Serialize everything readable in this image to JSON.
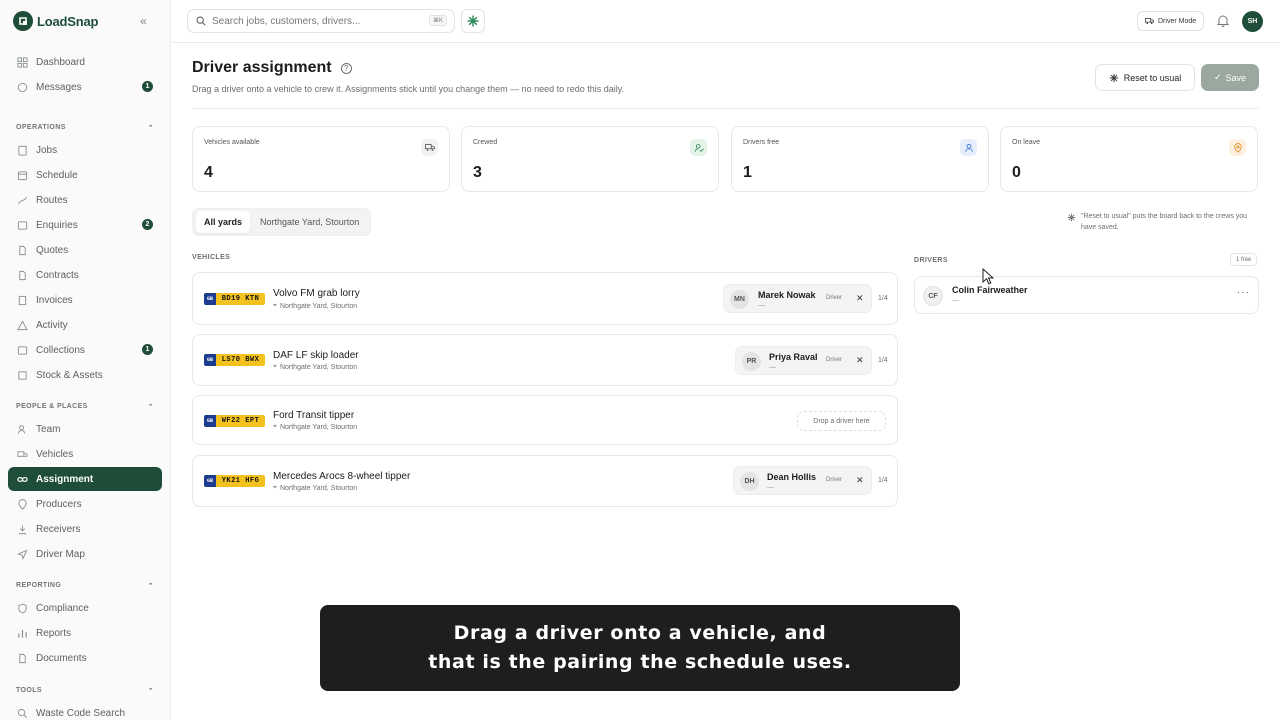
{
  "app": {
    "name": "LoadSnap",
    "user_initials": "SH"
  },
  "sidebar": {
    "top_items": [
      {
        "label": "Dashboard"
      },
      {
        "label": "Messages",
        "badge": "1"
      }
    ],
    "sections": [
      {
        "title": "OPERATIONS",
        "items": [
          {
            "label": "Jobs"
          },
          {
            "label": "Schedule"
          },
          {
            "label": "Routes"
          },
          {
            "label": "Enquiries",
            "badge": "2"
          },
          {
            "label": "Quotes"
          },
          {
            "label": "Contracts"
          },
          {
            "label": "Invoices"
          },
          {
            "label": "Activity"
          },
          {
            "label": "Collections",
            "badge": "1"
          },
          {
            "label": "Stock & Assets"
          }
        ]
      },
      {
        "title": "PEOPLE & PLACES",
        "items": [
          {
            "label": "Team"
          },
          {
            "label": "Vehicles"
          },
          {
            "label": "Assignment",
            "active": true
          },
          {
            "label": "Producers"
          },
          {
            "label": "Receivers"
          },
          {
            "label": "Driver Map"
          }
        ]
      },
      {
        "title": "REPORTING",
        "items": [
          {
            "label": "Compliance"
          },
          {
            "label": "Reports"
          },
          {
            "label": "Documents"
          }
        ]
      },
      {
        "title": "TOOLS",
        "items": [
          {
            "label": "Waste Code Search"
          }
        ]
      }
    ]
  },
  "topbar": {
    "search_placeholder": "Search jobs, customers, drivers...",
    "search_shortcut": "⌘K",
    "driver_mode_label": "Driver Mode"
  },
  "page": {
    "title": "Driver assignment",
    "subtitle": "Drag a driver onto a vehicle to crew it. Assignments stick until you change them — no need to redo this daily.",
    "reset_label": "Reset to usual",
    "save_label": "Save"
  },
  "stats": [
    {
      "label": "Vehicles available",
      "value": "4",
      "icon": "truck-icon",
      "color": "#f1f2f1"
    },
    {
      "label": "Crewed",
      "value": "3",
      "icon": "user-check-icon",
      "color": "#e3f3e8"
    },
    {
      "label": "Drivers free",
      "value": "1",
      "icon": "user-icon",
      "color": "#e6eefb"
    },
    {
      "label": "On leave",
      "value": "0",
      "icon": "map-pin-icon",
      "color": "#fdf0e0"
    }
  ],
  "filters": {
    "tabs": [
      "All yards",
      "Northgate Yard, Stourton"
    ],
    "active": 0,
    "reset_hint": "\"Reset to usual\" puts the board back to the crews you have saved."
  },
  "vehicles_label": "VEHICLES",
  "drivers_label": "DRIVERS",
  "drivers_free_label": "1 free",
  "vehicles": [
    {
      "plate_country": "GB",
      "plate": "BD19 KTN",
      "name": "Volvo FM grab lorry",
      "location": "Northgate Yard, Stourton",
      "driver": {
        "initials": "MN",
        "name": "Marek Nowak",
        "sub": "—",
        "role": "Driver"
      },
      "count": "1/4"
    },
    {
      "plate_country": "GB",
      "plate": "LS70 BWX",
      "name": "DAF LF skip loader",
      "location": "Northgate Yard, Stourton",
      "driver": {
        "initials": "PR",
        "name": "Priya Raval",
        "sub": "—",
        "role": "Driver"
      },
      "count": "1/4"
    },
    {
      "plate_country": "GB",
      "plate": "WF22 EPT",
      "name": "Ford Transit tipper",
      "location": "Northgate Yard, Stourton",
      "drop_label": "Drop a driver here"
    },
    {
      "plate_country": "GB",
      "plate": "YK21 HFG",
      "name": "Mercedes Arocs 8-wheel tipper",
      "location": "Northgate Yard, Stourton",
      "driver": {
        "initials": "DH",
        "name": "Dean Hollis",
        "sub": "—",
        "role": "Driver"
      },
      "count": "1/4"
    }
  ],
  "free_drivers": [
    {
      "initials": "CF",
      "name": "Colin Fairweather",
      "sub": "—"
    }
  ],
  "caption": {
    "line1": "Drag a driver onto a vehicle, and",
    "line2": "that is the pairing the schedule uses."
  }
}
